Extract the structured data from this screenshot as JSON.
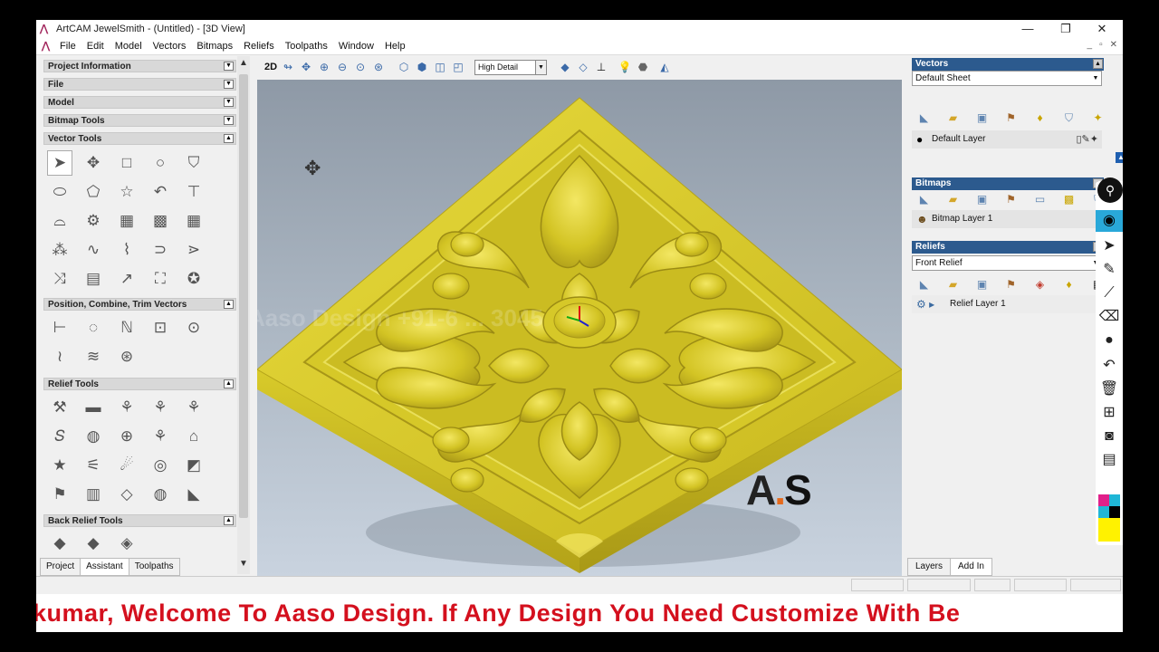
{
  "window": {
    "title": "ArtCAM JewelSmith - (Untitled) - [3D View]",
    "controls": [
      "—",
      "❐",
      "✕"
    ]
  },
  "menubar": {
    "items": [
      "File",
      "Edit",
      "Model",
      "Vectors",
      "Bitmaps",
      "Reliefs",
      "Toolpaths",
      "Window",
      "Help"
    ],
    "doc_controls": [
      "_",
      "▫",
      "✕"
    ]
  },
  "left_panel": {
    "sections": [
      {
        "label": "Project Information"
      },
      {
        "label": "File"
      },
      {
        "label": "Model"
      },
      {
        "label": "Bitmap Tools"
      },
      {
        "label": "Vector Tools"
      },
      {
        "label": "Position, Combine, Trim Vectors"
      },
      {
        "label": "Relief Tools"
      },
      {
        "label": "Back Relief Tools"
      }
    ],
    "vector_tool_glyphs": [
      "➤",
      "✥",
      "□",
      "○",
      "⛉",
      "⬭",
      "⬠",
      "☆",
      "↶",
      "⊤",
      "⌓",
      "⚙",
      "▦",
      "▩",
      "▦",
      "⁂",
      "∿",
      "⌇",
      "⊃",
      "⋗",
      "⤨",
      "▤",
      "↗",
      "⛶",
      "✪"
    ],
    "position_tool_glyphs": [
      "⊢",
      "◌",
      "ℕ",
      "⊡",
      "⊙",
      "≀",
      "≋",
      "⊛"
    ],
    "relief_tool_glyphs": [
      "⚒",
      "▬",
      "⚘",
      "⚘",
      "⚘",
      "𝑆",
      "◍",
      "⊕",
      "⚘",
      "⌂",
      "★",
      "⚟",
      "☄",
      "◎",
      "◩",
      "⚑",
      "▥",
      "◇",
      "◍",
      "◣"
    ],
    "back_relief_tool_glyphs": [
      "◆",
      "◆",
      "◈"
    ],
    "tabs": [
      "Project",
      "Assistant",
      "Toolpaths"
    ]
  },
  "toolbar": {
    "mode_label": "2D",
    "detail_value": "High Detail"
  },
  "view": {
    "watermark": "Aaso Design +91-6 ... 3045",
    "logo_text": "A",
    "logo_accent": "S"
  },
  "right_panel": {
    "vectors": {
      "header": "Vectors",
      "sheet": "Default Sheet",
      "layer": "Default Layer"
    },
    "bitmaps": {
      "header": "Bitmaps",
      "layer": "Bitmap Layer 1"
    },
    "reliefs": {
      "header": "Reliefs",
      "relief": "Front Relief",
      "layer": "Relief Layer 1"
    },
    "tabs": [
      "Layers",
      "Add In"
    ]
  },
  "annotation_toolbar": {
    "icons": [
      "pin-icon",
      "eye-icon",
      "cursor-icon",
      "highlighter-icon",
      "line-icon",
      "eraser-icon",
      "dot-icon",
      "undo-icon",
      "trash-icon",
      "projector-icon",
      "camera-icon",
      "clipboard-icon"
    ]
  },
  "ticker": {
    "text": "kumar, Welcome To Aaso Design. If Any Design You Need Customize With Be"
  },
  "colors": {
    "relief_gold": "#d9cb2a",
    "header_blue": "#2c5a8e",
    "ticker_red": "#d4101e"
  }
}
